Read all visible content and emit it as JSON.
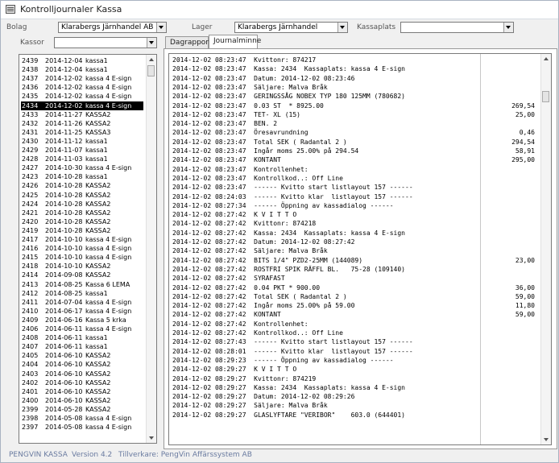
{
  "window": {
    "title": "Kontrolljournaler Kassa"
  },
  "filters": {
    "bolag_label": "Bolag",
    "bolag_value": "Klarabergs  Järnhandel AB",
    "lager_label": "Lager",
    "lager_value": "Klarabergs Järnhandel",
    "kassaplats_label": "Kassaplats",
    "kassaplats_value": ""
  },
  "kassor": {
    "label": "Kassor",
    "filter_value": ""
  },
  "tabs": [
    "Dagrapport",
    "Journalminne"
  ],
  "active_tab": 1,
  "list": [
    [
      "2439",
      "2014-12-04",
      "kassa1"
    ],
    [
      "2438",
      "2014-12-04",
      "kassa1"
    ],
    [
      "2437",
      "2014-12-02",
      "kassa 4 E-sign"
    ],
    [
      "2436",
      "2014-12-02",
      "kassa 4 E-sign"
    ],
    [
      "2435",
      "2014-12-02",
      "kassa 4 E-sign"
    ],
    [
      "2434",
      "2014-12-02",
      "kassa 4 E-sign"
    ],
    [
      "2433",
      "2014-11-27",
      "KASSA2"
    ],
    [
      "2432",
      "2014-11-26",
      "KASSA2"
    ],
    [
      "2431",
      "2014-11-25",
      "KASSA3"
    ],
    [
      "2430",
      "2014-11-12",
      "kassa1"
    ],
    [
      "2429",
      "2014-11-07",
      "kassa1"
    ],
    [
      "2428",
      "2014-11-03",
      "kassa1"
    ],
    [
      "2427",
      "2014-10-30",
      "kassa 4 E-sign"
    ],
    [
      "2423",
      "2014-10-28",
      "kassa1"
    ],
    [
      "2426",
      "2014-10-28",
      "KASSA2"
    ],
    [
      "2425",
      "2014-10-28",
      "KASSA2"
    ],
    [
      "2424",
      "2014-10-28",
      "KASSA2"
    ],
    [
      "2421",
      "2014-10-28",
      "KASSA2"
    ],
    [
      "2420",
      "2014-10-28",
      "KASSA2"
    ],
    [
      "2419",
      "2014-10-28",
      "KASSA2"
    ],
    [
      "2417",
      "2014-10-10",
      "kassa 4 E-sign"
    ],
    [
      "2416",
      "2014-10-10",
      "kassa 4 E-sign"
    ],
    [
      "2415",
      "2014-10-10",
      "kassa 4 E-sign"
    ],
    [
      "2418",
      "2014-10-10",
      "KASSA2"
    ],
    [
      "2414",
      "2014-09-08",
      "KASSA2"
    ],
    [
      "2413",
      "2014-08-25",
      "Kassa 6 LEMA"
    ],
    [
      "2412",
      "2014-08-25",
      "kassa1"
    ],
    [
      "2411",
      "2014-07-04",
      "kassa 4 E-sign"
    ],
    [
      "2410",
      "2014-06-17",
      "kassa 4 E-sign"
    ],
    [
      "2409",
      "2014-06-16",
      "Kassa 5 krka"
    ],
    [
      "2406",
      "2014-06-11",
      "kassa 4 E-sign"
    ],
    [
      "2408",
      "2014-06-11",
      "kassa1"
    ],
    [
      "2407",
      "2014-06-11",
      "kassa1"
    ],
    [
      "2405",
      "2014-06-10",
      "KASSA2"
    ],
    [
      "2404",
      "2014-06-10",
      "KASSA2"
    ],
    [
      "2403",
      "2014-06-10",
      "KASSA2"
    ],
    [
      "2402",
      "2014-06-10",
      "KASSA2"
    ],
    [
      "2401",
      "2014-06-10",
      "KASSA2"
    ],
    [
      "2400",
      "2014-06-10",
      "KASSA2"
    ],
    [
      "2399",
      "2014-05-28",
      "KASSA2"
    ],
    [
      "2398",
      "2014-05-08",
      "kassa 4 E-sign"
    ],
    [
      "2397",
      "2014-05-08",
      "kassa 4 E-sign"
    ]
  ],
  "selected_index": 5,
  "journal": [
    [
      "2014-12-02 08:23:47",
      "Kvittonr: 874217",
      ""
    ],
    [
      "2014-12-02 08:23:47",
      "Kassa: 2434  Kassaplats: kassa 4 E-sign",
      ""
    ],
    [
      "2014-12-02 08:23:47",
      "Datum: 2014-12-02 08:23:46",
      ""
    ],
    [
      "2014-12-02 08:23:47",
      "Säljare: Malva Bråk",
      ""
    ],
    [
      "2014-12-02 08:23:47",
      "GERINGSSÅG NOBEX TYP 180 125MM (780682)",
      ""
    ],
    [
      "2014-12-02 08:23:47",
      "0.03 ST  * 8925.00",
      "269,54"
    ],
    [
      "2014-12-02 08:23:47",
      "TET- XL (15)",
      "25,00"
    ],
    [
      "2014-12-02 08:23:47",
      "BEN. 2",
      ""
    ],
    [
      "2014-12-02 08:23:47",
      "Öresavrundning",
      "0,46"
    ],
    [
      "2014-12-02 08:23:47",
      "Total SEK ( Radantal 2 )",
      "294,54"
    ],
    [
      "2014-12-02 08:23:47",
      "Ingår moms 25.00% på 294.54",
      "58,91"
    ],
    [
      "2014-12-02 08:23:47",
      "KONTANT",
      "295,00"
    ],
    [
      "2014-12-02 08:23:47",
      "Kontrollenhet:",
      ""
    ],
    [
      "2014-12-02 08:23:47",
      "Kontrollkod..: Off Line",
      ""
    ],
    [
      "2014-12-02 08:23:47",
      "------ Kvitto start listlayout 157 ------",
      ""
    ],
    [
      "2014-12-02 08:24:03",
      "------ Kvitto klar  listlayout 157 ------",
      ""
    ],
    [
      "2014-12-02 08:27:34",
      "------ Öppning av kassadialog ------",
      ""
    ],
    [
      "2014-12-02 08:27:42",
      "K V I T T O",
      ""
    ],
    [
      "2014-12-02 08:27:42",
      "Kvittonr: 874218",
      ""
    ],
    [
      "2014-12-02 08:27:42",
      "Kassa: 2434  Kassaplats: kassa 4 E-sign",
      ""
    ],
    [
      "2014-12-02 08:27:42",
      "Datum: 2014-12-02 08:27:42",
      ""
    ],
    [
      "2014-12-02 08:27:42",
      "Säljare: Malva Bråk",
      ""
    ],
    [
      "2014-12-02 08:27:42",
      "BITS 1/4\" PZD2-25MM (144089)",
      "23,00"
    ],
    [
      "2014-12-02 08:27:42",
      "ROSTFRI SPIK RÄFFL BL.   75-28 (109140)",
      ""
    ],
    [
      "2014-12-02 08:27:42",
      "SYRAFAST",
      ""
    ],
    [
      "2014-12-02 08:27:42",
      "0.04 PKT * 900.00",
      "36,00"
    ],
    [
      "2014-12-02 08:27:42",
      "Total SEK ( Radantal 2 )",
      "59,00"
    ],
    [
      "2014-12-02 08:27:42",
      "Ingår moms 25.00% på 59.00",
      "11,80"
    ],
    [
      "2014-12-02 08:27:42",
      "KONTANT",
      "59,00"
    ],
    [
      "2014-12-02 08:27:42",
      "Kontrollenhet:",
      ""
    ],
    [
      "2014-12-02 08:27:42",
      "Kontrollkod..: Off Line",
      ""
    ],
    [
      "2014-12-02 08:27:43",
      "------ Kvitto start listlayout 157 ------",
      ""
    ],
    [
      "2014-12-02 08:28:01",
      "------ Kvitto klar  listlayout 157 ------",
      ""
    ],
    [
      "2014-12-02 08:29:23",
      "------ Öppning av kassadialog ------",
      ""
    ],
    [
      "2014-12-02 08:29:27",
      "K V I T T O",
      ""
    ],
    [
      "2014-12-02 08:29:27",
      "Kvittonr: 874219",
      ""
    ],
    [
      "2014-12-02 08:29:27",
      "Kassa: 2434  Kassaplats: kassa 4 E-sign",
      ""
    ],
    [
      "2014-12-02 08:29:27",
      "Datum: 2014-12-02 08:29:26",
      ""
    ],
    [
      "2014-12-02 08:29:27",
      "Säljare: Malva Bråk",
      ""
    ],
    [
      "2014-12-02 08:29:27",
      "GLASLYFTARE \"VERIBOR\"    603.0 (644401)",
      ""
    ]
  ],
  "status": {
    "product": "PENGVIN KASSA",
    "version": "Version  4.2",
    "vendor": "Tillverkare: PengVin Affärssystem AB"
  }
}
